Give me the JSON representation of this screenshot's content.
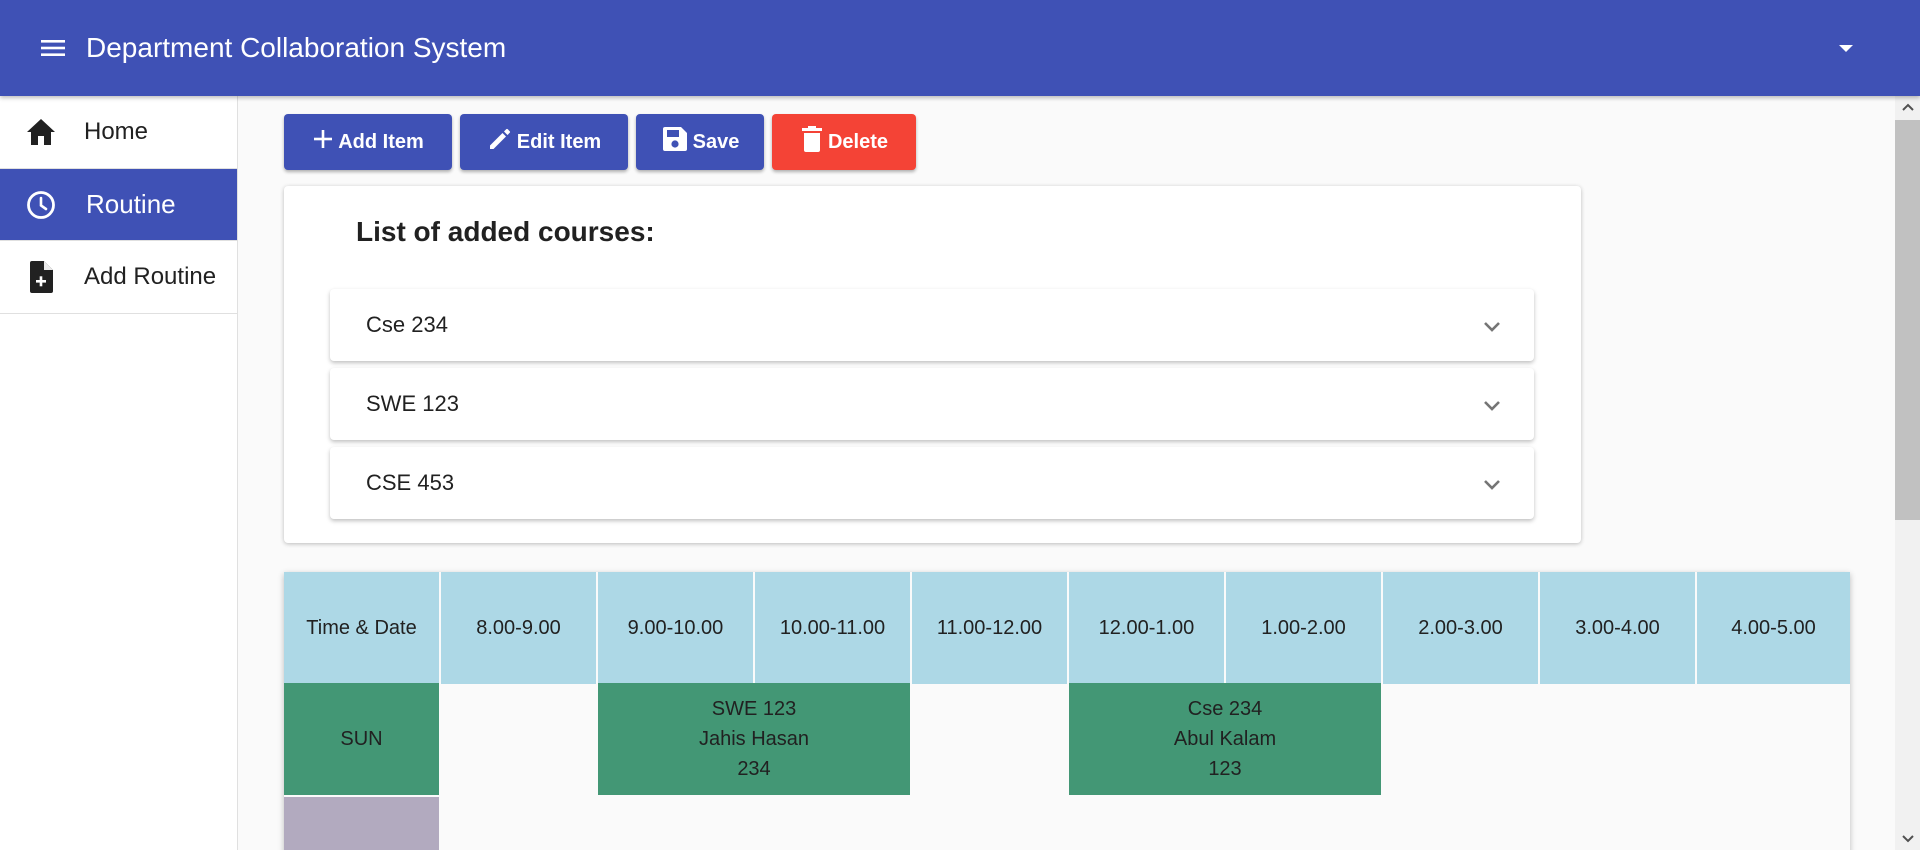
{
  "app": {
    "title": "Department Collaboration System"
  },
  "sidebar": {
    "items": [
      {
        "label": "Home",
        "icon": "home-icon"
      },
      {
        "label": "Routine",
        "icon": "clock-icon",
        "active": true
      },
      {
        "label": "Add Routine",
        "icon": "add-file-icon"
      }
    ]
  },
  "toolbar": {
    "add_label": "Add Item",
    "edit_label": "Edit Item",
    "save_label": "Save",
    "delete_label": "Delete"
  },
  "courses": {
    "title": "List of added courses:",
    "items": [
      "Cse 234",
      "SWE 123",
      "CSE 453"
    ]
  },
  "routine": {
    "headers": [
      "Time & Date",
      "8.00-9.00",
      "9.00-10.00",
      "10.00-11.00",
      "11.00-12.00",
      "12.00-1.00",
      "1.00-2.00",
      "2.00-3.00",
      "3.00-4.00",
      "4.00-5.00"
    ],
    "rows": [
      {
        "day": "SUN",
        "classes": [
          {
            "course": "SWE 123",
            "teacher": "Jahis Hasan",
            "room": "234"
          },
          {
            "course": "Cse 234",
            "teacher": "Abul Kalam",
            "room": "123"
          }
        ]
      }
    ]
  },
  "colors": {
    "primary": "#3f51b5",
    "danger": "#f44336",
    "header_cell": "#add8e6",
    "day_sun": "#439775",
    "class_cell": "#439775",
    "day_next": "#b2aabf"
  }
}
